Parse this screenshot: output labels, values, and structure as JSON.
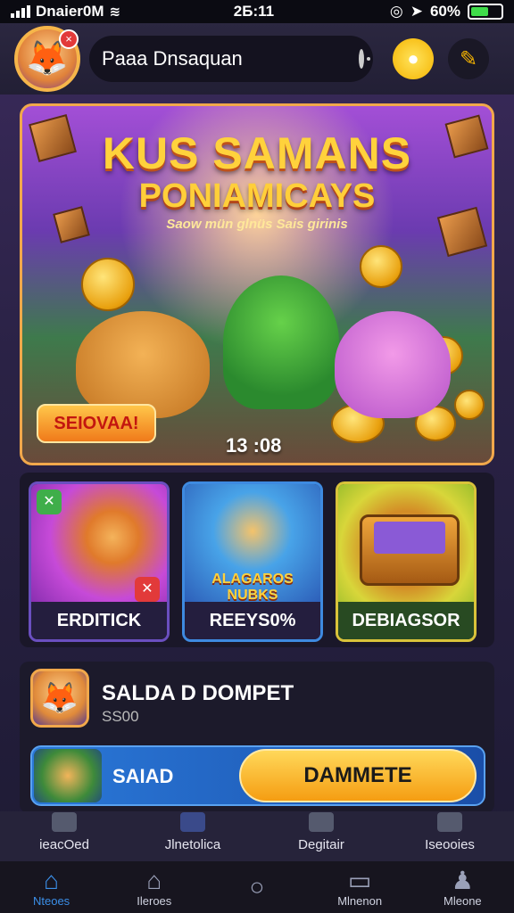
{
  "status_bar": {
    "carrier": "Dnaier0M",
    "time": "2Б:11",
    "battery": "60%",
    "battery_level": 0.6
  },
  "header": {
    "search_value": "Paaa Dnsaquan",
    "avatar_icon": "fox-avatar-icon",
    "coin_icon": "coin-icon",
    "edit_icon": "pencil-icon"
  },
  "hero": {
    "title": "KUS SAMANS",
    "subtitle": "PONIAMICAYS",
    "tagline": "Saow mün glnüs Sais girinis",
    "cta_label": "SEIOVAA!",
    "timer": "13 :08"
  },
  "categories": [
    {
      "label": "ERDITICK",
      "art_icon": "dog-character-icon"
    },
    {
      "label": "REEYS0%",
      "art_text": "ALAGAROS NUBKS",
      "art_icon": "heroes-group-icon"
    },
    {
      "label": "DEBIAGSOR",
      "art_icon": "treasure-chest-icon"
    }
  ],
  "wallet": {
    "title": "SALDA D DOMPET",
    "amount": "SS00",
    "bar_label": "SAIAD",
    "deposit_label": "DAMMETE"
  },
  "sub_nav": [
    {
      "label": "ieacOed"
    },
    {
      "label": "Jlnetolica"
    },
    {
      "label": "Degitair"
    },
    {
      "label": "Iseooies"
    }
  ],
  "bottom_nav": [
    {
      "label": "Nteoes",
      "icon": "home-icon",
      "glyph": "⌂",
      "active": true
    },
    {
      "label": "Ileroes",
      "icon": "home-outline-icon",
      "glyph": "⌂",
      "active": false
    },
    {
      "label": "",
      "icon": "search-icon",
      "glyph": "○",
      "active": false
    },
    {
      "label": "Mlnenon",
      "icon": "book-icon",
      "glyph": "▭",
      "active": false
    },
    {
      "label": "Mleone",
      "icon": "user-icon",
      "glyph": "♟",
      "active": false
    }
  ]
}
